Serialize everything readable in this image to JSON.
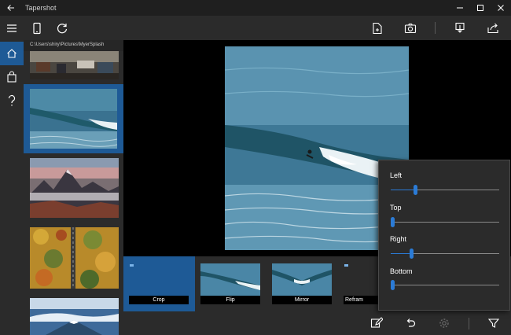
{
  "app": {
    "title": "Tapershot",
    "window_buttons": [
      "minimize-icon",
      "maximize-icon",
      "close-icon"
    ]
  },
  "toolbar": {
    "left_icons": [
      "phone-icon",
      "refresh-icon"
    ],
    "right_icons": [
      "new-file-icon",
      "camera-icon",
      "save-icon",
      "share-icon"
    ]
  },
  "nav": {
    "items": [
      {
        "name": "menu",
        "icon": "hamburger-icon"
      },
      {
        "name": "home",
        "icon": "home-icon",
        "active": true
      },
      {
        "name": "store",
        "icon": "shopping-bag-icon"
      },
      {
        "name": "help",
        "icon": "help-icon"
      }
    ]
  },
  "gallery": {
    "path": "C:\\Users\\shiry\\Pictures\\MyerSplash",
    "thumbnails": [
      {
        "subject": "street market"
      },
      {
        "subject": "surfer on wave",
        "selected": true
      },
      {
        "subject": "mountains"
      },
      {
        "subject": "autumn forest road"
      },
      {
        "subject": "snowy mountain"
      }
    ]
  },
  "effects": [
    {
      "label": "Crop",
      "selected": true
    },
    {
      "label": "Flip"
    },
    {
      "label": "Mirror"
    },
    {
      "label": "Refram"
    }
  ],
  "bottombar": {
    "icons": [
      "edit-icon",
      "undo-icon",
      "settings-icon",
      "filter-icon"
    ]
  },
  "sliders": [
    {
      "label": "Left",
      "value": 0.22
    },
    {
      "label": "Top",
      "value": 0.0
    },
    {
      "label": "Right",
      "value": 0.18
    },
    {
      "label": "Bottom",
      "value": 0.0
    }
  ],
  "colors": {
    "accent": "#1e5a96",
    "slider": "#2b7bd6",
    "background": "#2b2b2b"
  }
}
